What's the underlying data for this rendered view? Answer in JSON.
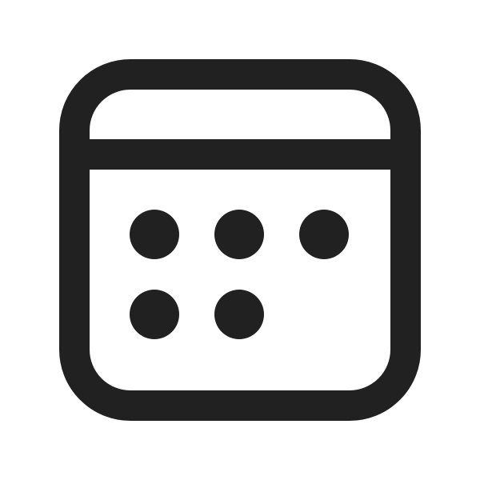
{
  "icon": {
    "name": "calendar-icon",
    "stroke_color": "#212121",
    "fill_color": "#212121",
    "background_color": "#ffffff",
    "date_dots_rows": [
      3,
      2
    ]
  }
}
